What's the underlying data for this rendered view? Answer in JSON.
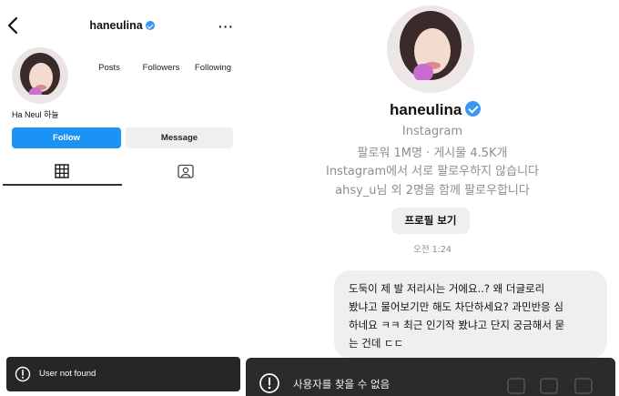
{
  "left": {
    "username": "haneulina",
    "stats": {
      "posts": "Posts",
      "followers": "Followers",
      "following": "Following"
    },
    "full_name": "Ha Neul 하늘",
    "buttons": {
      "follow": "Follow",
      "message": "Message"
    },
    "toast": "User not found"
  },
  "right": {
    "username": "haneulina",
    "platform": "Instagram",
    "stats_line": "팔로워 1M명 · 게시물 4.5K개",
    "mutual_status": "Instagram에서 서로 팔로우하지 않습니다",
    "followed_by": "ahsy_u님 외 2명을 함께 팔로우합니다",
    "view_profile": "프로필 보기",
    "timestamp": "오전 1:24",
    "message_lines": [
      "도둑이 제 발 저리시는 거에요..? 왜 더글로리",
      "봤냐고 물어보기만 해도 차단하세요? 과민반응 심",
      "하네요 ㅋㅋ 최근 인기작 봤냐고 단지 궁금해서 묻",
      "는 건데 ㄷㄷ"
    ],
    "toast": "사용자를 찾을 수 없음"
  },
  "colors": {
    "accent": "#1a93f5",
    "verified": "#3897f0",
    "toast_bg": "#262626"
  }
}
